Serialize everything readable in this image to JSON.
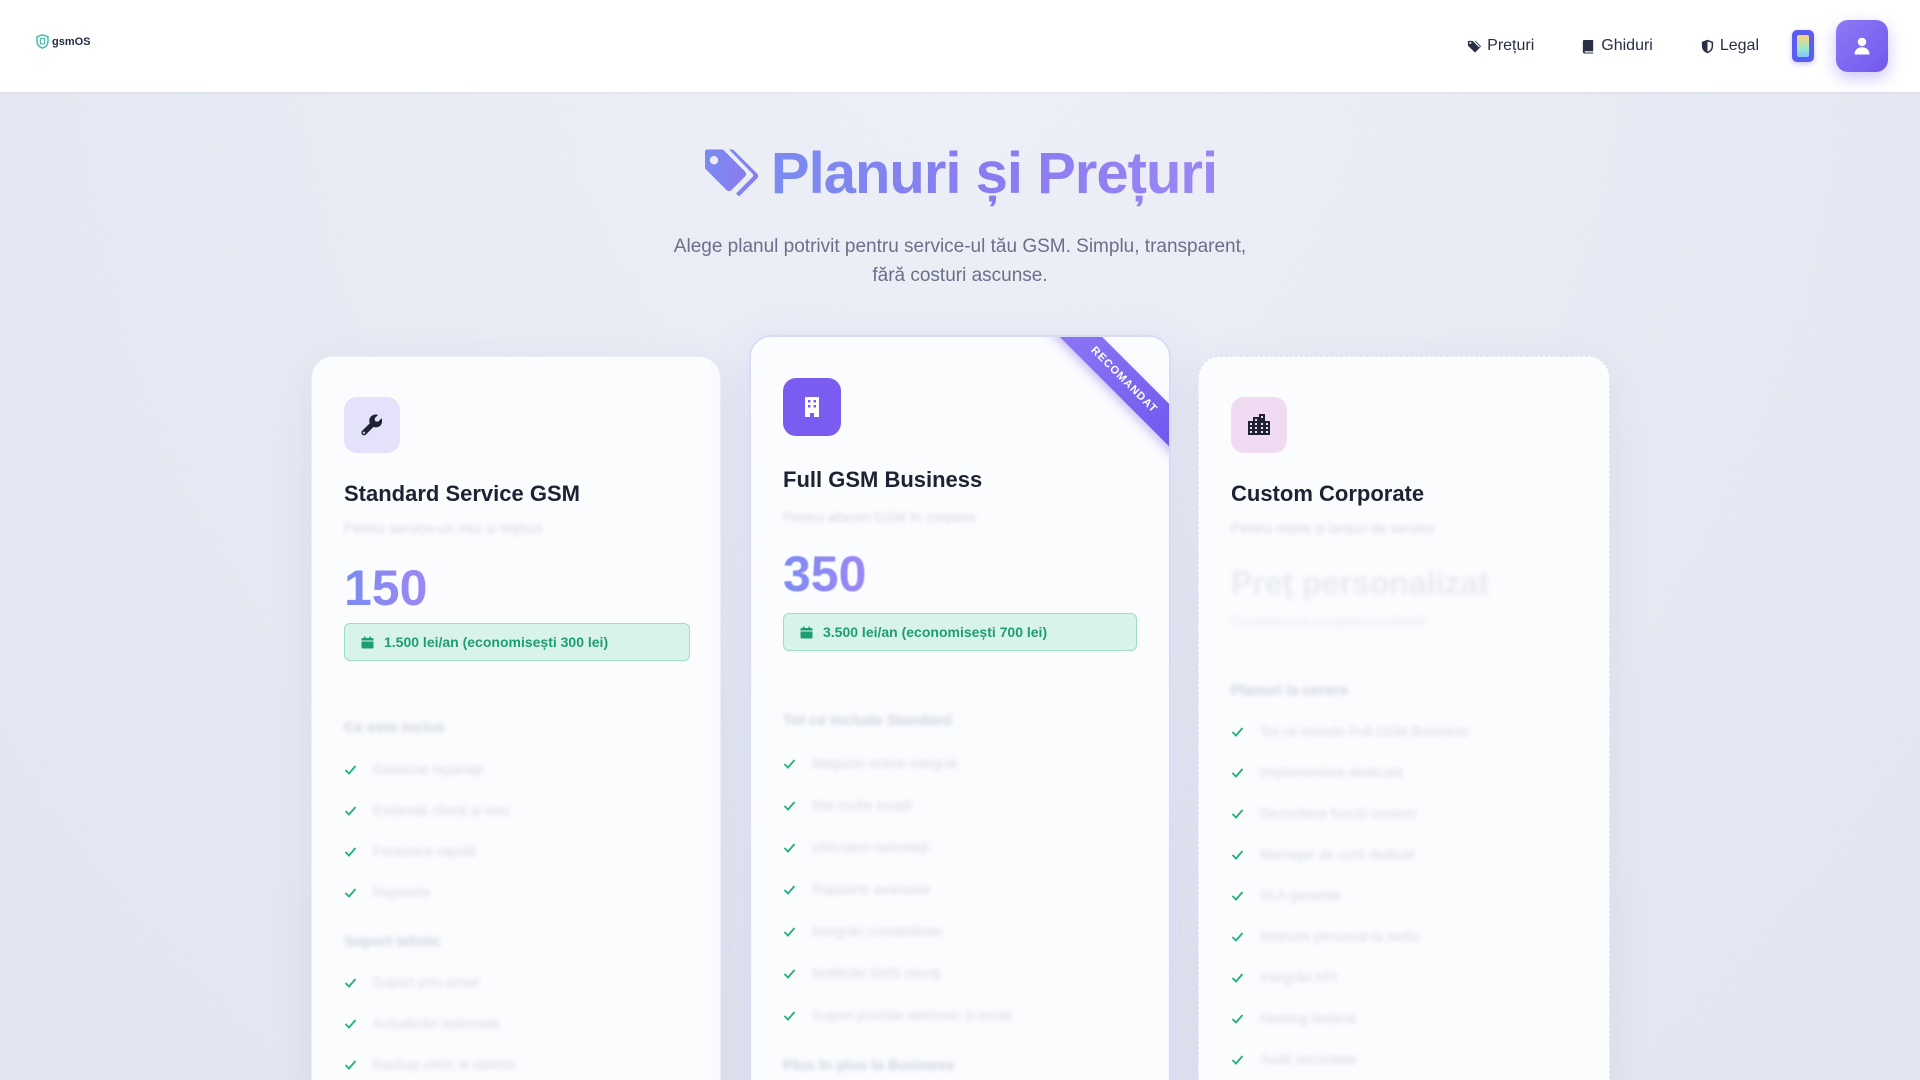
{
  "header": {
    "logo_text": "gsmOS",
    "nav": [
      {
        "label": "Prețuri",
        "icon": "tags-icon"
      },
      {
        "label": "Ghiduri",
        "icon": "book-icon"
      },
      {
        "label": "Legal",
        "icon": "shield-icon"
      }
    ]
  },
  "hero": {
    "title": "Planuri și Prețuri",
    "subtitle": "Alege planul potrivit pentru service-ul tău GSM. Simplu, transparent, fără costuri ascunse."
  },
  "plans": [
    {
      "name": "Standard Service GSM",
      "description": "Pentru service-uri mici și mijlocii",
      "price": "150",
      "annual": "1.500 lei/an (economisești 300 lei)",
      "icon": "wrench-icon",
      "section1": "Ce este inclus",
      "features1": [
        "Gestiune reparații",
        "Evidență clienți și stoc",
        "Facturare rapidă",
        "Rapoarte"
      ],
      "section2": "Suport tehnic",
      "features2": [
        "Suport prin email",
        "Actualizări automate",
        "Backup zilnic al datelor"
      ]
    },
    {
      "name": "Full GSM Business",
      "description": "Pentru afaceri GSM în creștere",
      "price": "350",
      "annual": "3.500 lei/an (economisești 700 lei)",
      "icon": "building-icon",
      "badge": "RECOMANDAT",
      "section1": "Tot ce include Standard",
      "features1": [
        "Magazin online integrat",
        "Mai multe locații",
        "Utilizatori nelimitați",
        "Rapoarte avansate",
        "Integrări contabilitate",
        "Notificări SMS clienți",
        "Suport prioritar telefonic și email"
      ],
      "section2": "Plus în plus la Business"
    },
    {
      "name": "Custom Corporate",
      "description": "Pentru rețele și lanțuri de service",
      "price_label": "Preț personalizat",
      "price_sub": "Contactează-ne pentru o ofertă",
      "icon": "city-icon",
      "section1": "Planuri la cerere",
      "features1": [
        "Tot ce include Full GSM Business",
        "Implementare dedicată",
        "Dezvoltare funcții custom",
        "Manager de cont dedicat",
        "SLA garantat",
        "Instruire personal la sediu",
        "Integrări API",
        "Hosting dedicat",
        "Audit securitate"
      ]
    }
  ],
  "colors": {
    "accent": "#7357ee",
    "check": "#22b07d",
    "annual_bg": "#d8f3ea"
  }
}
